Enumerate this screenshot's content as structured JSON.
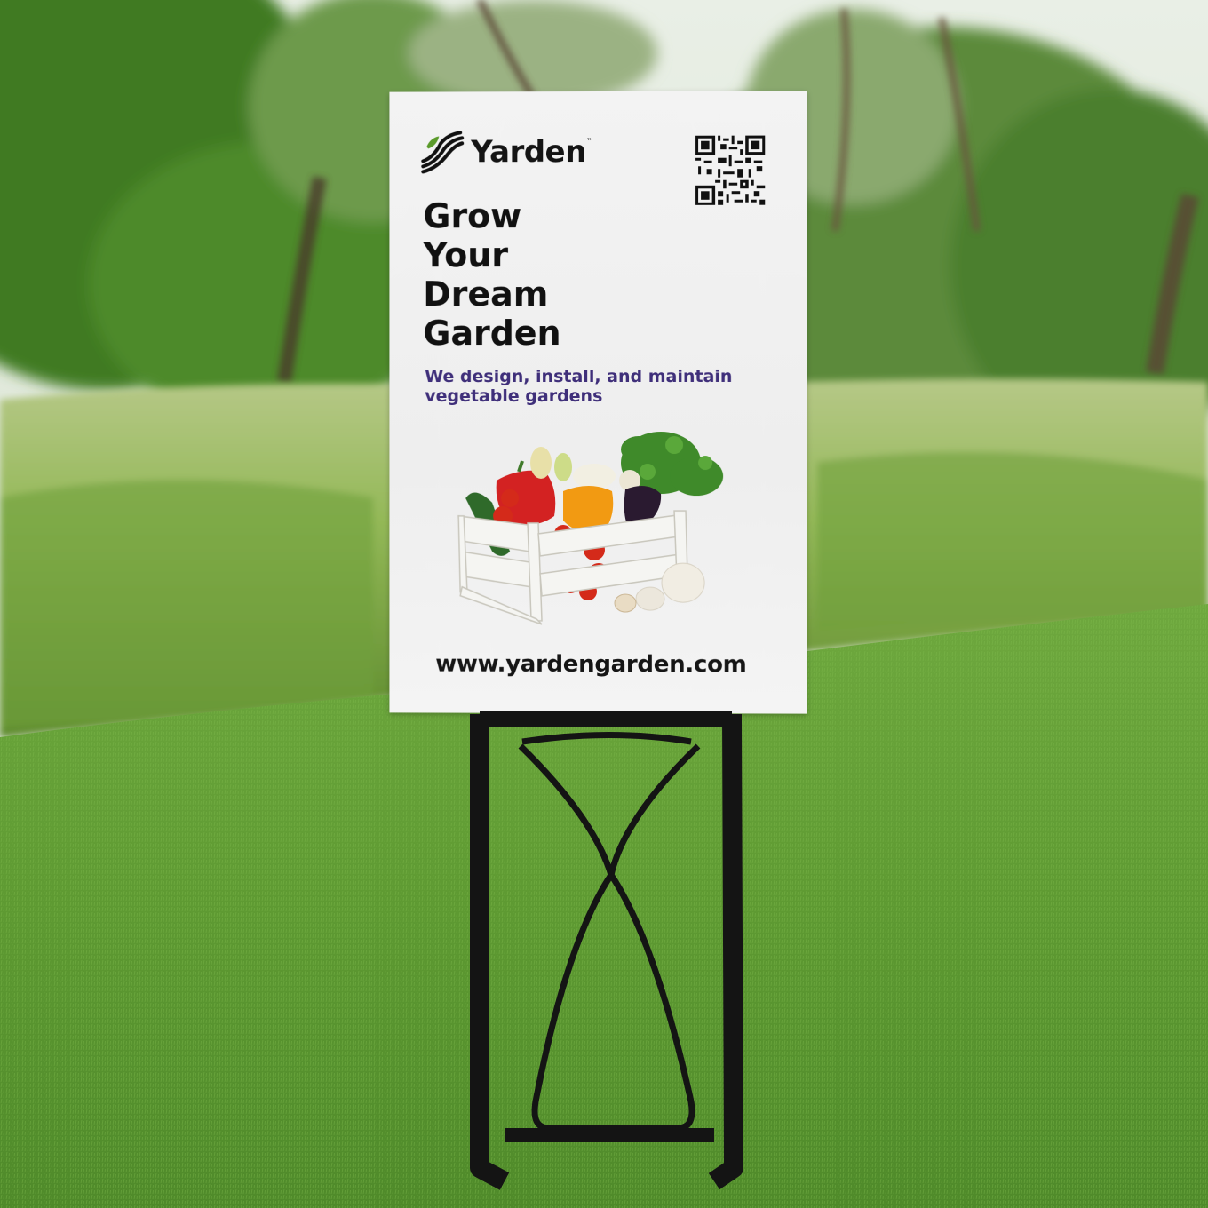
{
  "brand": {
    "name": "Yarden",
    "trademark": "™"
  },
  "headline": [
    "Grow",
    "Your",
    "Dream",
    "Garden"
  ],
  "tagline": "We design, install, and maintain vegetable gardens",
  "website": "www.yardengarden.com",
  "icons": {
    "logo": "leaf-stripes-logo-icon",
    "qr": "qr-code-icon",
    "image": "vegetable-crate-photo"
  },
  "colors": {
    "sign_background": "#efefef",
    "headline": "#111111",
    "tagline": "#3f2f7a",
    "logo_leaf": "#5a9a2a",
    "stake": "#111111",
    "lawn": "#5f9a35"
  }
}
